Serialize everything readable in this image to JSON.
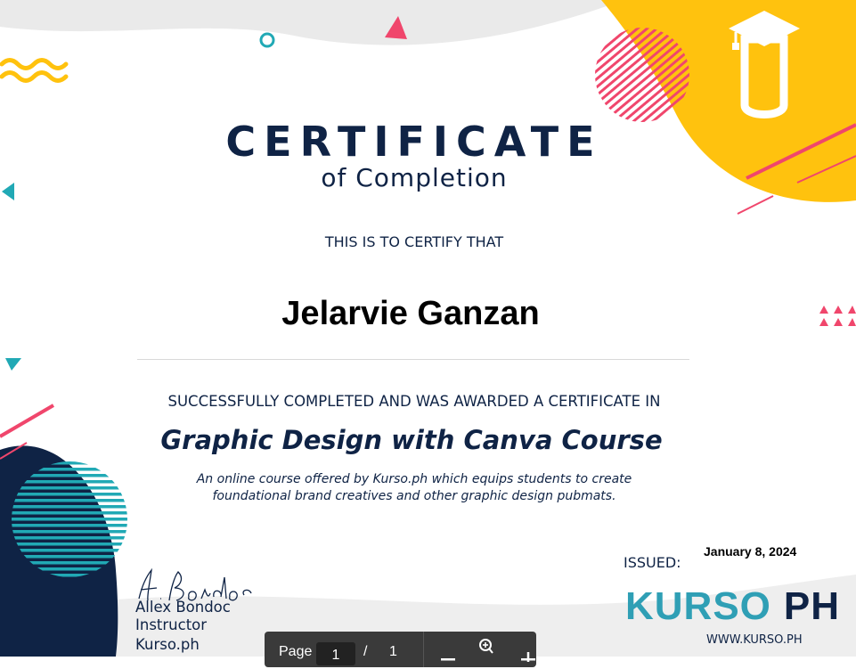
{
  "certificate": {
    "title": "CERTIFICATE",
    "subtitle": "of Completion",
    "certify_text": "THIS IS TO CERTIFY THAT",
    "recipient_name": "Jelarvie Ganzan",
    "completed_text": "SUCCESSFULLY COMPLETED AND WAS AWARDED A CERTIFICATE IN",
    "course_name": "Graphic Design with Canva Course",
    "description": "An online course offered by Kurso.ph which equips students to create foundational brand creatives and other graphic design pubmats."
  },
  "signatory": {
    "signature_script": "A. Bondoc",
    "name": "Allex Bondoc",
    "role": "Instructor",
    "organization": "Kurso.ph"
  },
  "issuer": {
    "issued_label": "ISSUED:",
    "issued_date": "January 8, 2024",
    "brand_name_part1": "KURSO",
    "brand_name_part2": "PH",
    "website": "WWW.KURSO.PH"
  },
  "viewer_toolbar": {
    "page_label": "Page",
    "current_page": "1",
    "separator": "/",
    "total_pages": "1",
    "zoom_out_icon": "minus-icon",
    "zoom_icon": "magnifier-icon",
    "zoom_in_icon": "plus-icon"
  },
  "colors": {
    "navy": "#0f2345",
    "yellow": "#ffc20e",
    "teal": "#2f9fb5",
    "pink": "#f0466c",
    "toolbar_bg": "#3a3a3a"
  }
}
